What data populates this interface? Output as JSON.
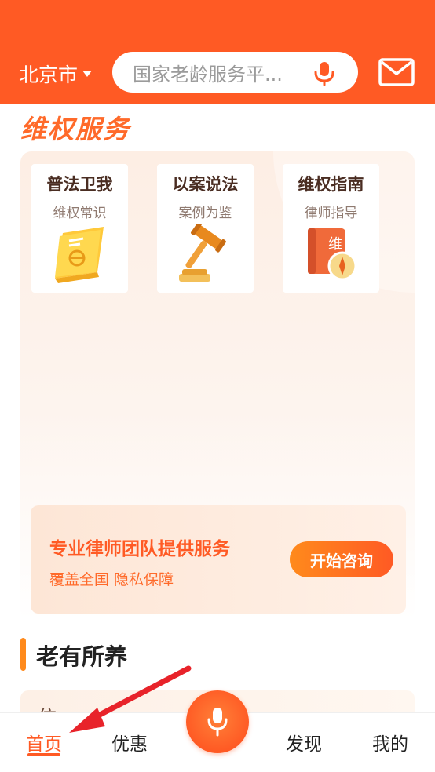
{
  "header": {
    "city": "北京市",
    "search_placeholder": "国家老龄服务平...",
    "icons": [
      "caret-down-icon",
      "microphone-icon",
      "mail-icon"
    ]
  },
  "rights": {
    "title": "维权服务",
    "cards": [
      {
        "title": "普法卫我",
        "subtitle": "维权常识",
        "icon": "law-book-icon"
      },
      {
        "title": "以案说法",
        "subtitle": "案例为鉴",
        "icon": "gavel-icon"
      },
      {
        "title": "维权指南",
        "subtitle": "律师指导",
        "icon": "guide-compass-icon",
        "icon_text": "维"
      }
    ],
    "banner": {
      "title": "专业律师团队提供服务",
      "subtitle": "覆盖全国 隐私保障",
      "button": "开始咨询"
    }
  },
  "elderly": {
    "title": "老有所养",
    "peek_text": "住..."
  },
  "tabbar": {
    "tabs": [
      {
        "label": "首页",
        "active": true
      },
      {
        "label": "优惠",
        "active": false
      },
      {
        "label": "发现",
        "active": false
      },
      {
        "label": "我的",
        "active": false
      }
    ]
  },
  "colors": {
    "brand": "#ff5a24",
    "accent": "#ff8a1c"
  }
}
